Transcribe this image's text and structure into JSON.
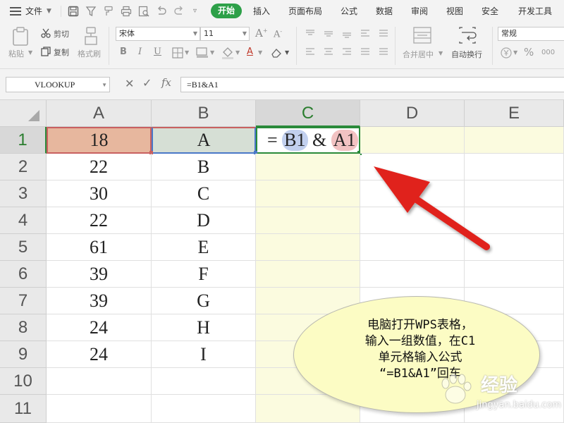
{
  "menu": {
    "file": "文件",
    "tabs": [
      "开始",
      "插入",
      "页面布局",
      "公式",
      "数据",
      "审阅",
      "视图",
      "安全",
      "开发工具"
    ]
  },
  "ribbon": {
    "paste": "粘贴",
    "cut": "剪切",
    "copy": "复制",
    "format_painter": "格式刷",
    "font_name": "宋体",
    "font_size": "11",
    "merge_center": "合并居中",
    "wrap_text": "自动换行",
    "number_format": "常规",
    "percent": "%",
    "decimal": "000"
  },
  "formula_bar": {
    "name_box": "VLOOKUP",
    "fx": "fx",
    "formula": "=B1&A1"
  },
  "grid": {
    "columns": [
      "A",
      "B",
      "C",
      "D",
      "E"
    ],
    "rows": [
      "1",
      "2",
      "3",
      "4",
      "5",
      "6",
      "7",
      "8",
      "9",
      "10",
      "11"
    ],
    "col_a": [
      "18",
      "22",
      "30",
      "22",
      "61",
      "39",
      "39",
      "24",
      "24",
      "",
      ""
    ],
    "col_b": [
      "A",
      "B",
      "C",
      "D",
      "E",
      "F",
      "G",
      "H",
      "I",
      "",
      ""
    ],
    "c1_formula": {
      "eq": "=",
      "ref1": "B1",
      "amp": "&",
      "ref2": "A1"
    },
    "active_cell": "C1"
  },
  "callout": {
    "lines": [
      "电脑打开WPS表格，",
      "输入一组数值，在C1",
      "单元格输入公式",
      "“=B1&A1”回车"
    ]
  },
  "watermark": {
    "brand": "经验",
    "url": "jingyan.baidu.com"
  },
  "colors": {
    "accent_green": "#2da048",
    "selected_col": "#fbfbdf",
    "ref_a1": "#f2c2c2",
    "ref_b1": "#c2d0ee",
    "arrow": "#e0241c"
  }
}
